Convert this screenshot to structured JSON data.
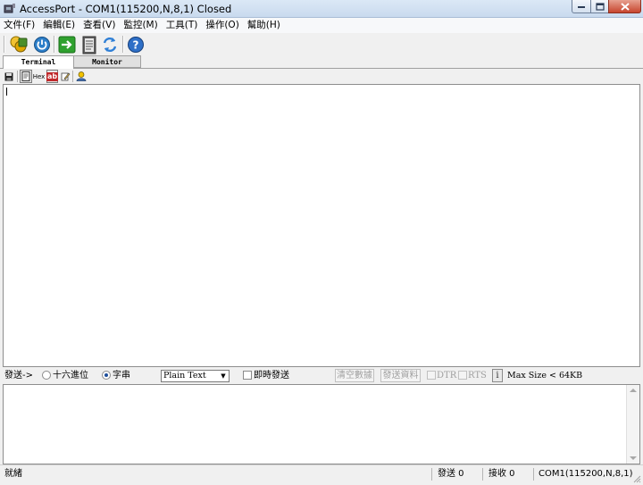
{
  "window": {
    "title": "AccessPort - COM1(115200,N,8,1) Closed"
  },
  "menu": [
    "文件(F)",
    "編輯(E)",
    "查看(V)",
    "監控(M)",
    "工具(T)",
    "操作(O)",
    "幫助(H)"
  ],
  "toolbar": {
    "icons": [
      "coins-icon",
      "power-icon",
      "go-arrow-icon",
      "notepad-icon",
      "refresh-icon",
      "help-icon"
    ]
  },
  "tabs": [
    "Terminal",
    "Monitor"
  ],
  "subtoolbar": {
    "hex_label": "Hex",
    "ab_label": "ab"
  },
  "sendbar": {
    "send_label": "發送->",
    "radio_hex": "十六進位",
    "radio_string": "字串",
    "radio_selected": "字串",
    "format_value": "Plain Text",
    "instant_send": "即時發送",
    "clear_button": "清空數據",
    "send_button": "發送資料",
    "dtr": "DTR",
    "rts": "RTS",
    "info_button": "i",
    "max_size": "Max Size < 64KB"
  },
  "status": {
    "ready": "就緒",
    "sent": "發送 0",
    "received": "接收 0",
    "port": "COM1(115200,N,8,1)"
  }
}
